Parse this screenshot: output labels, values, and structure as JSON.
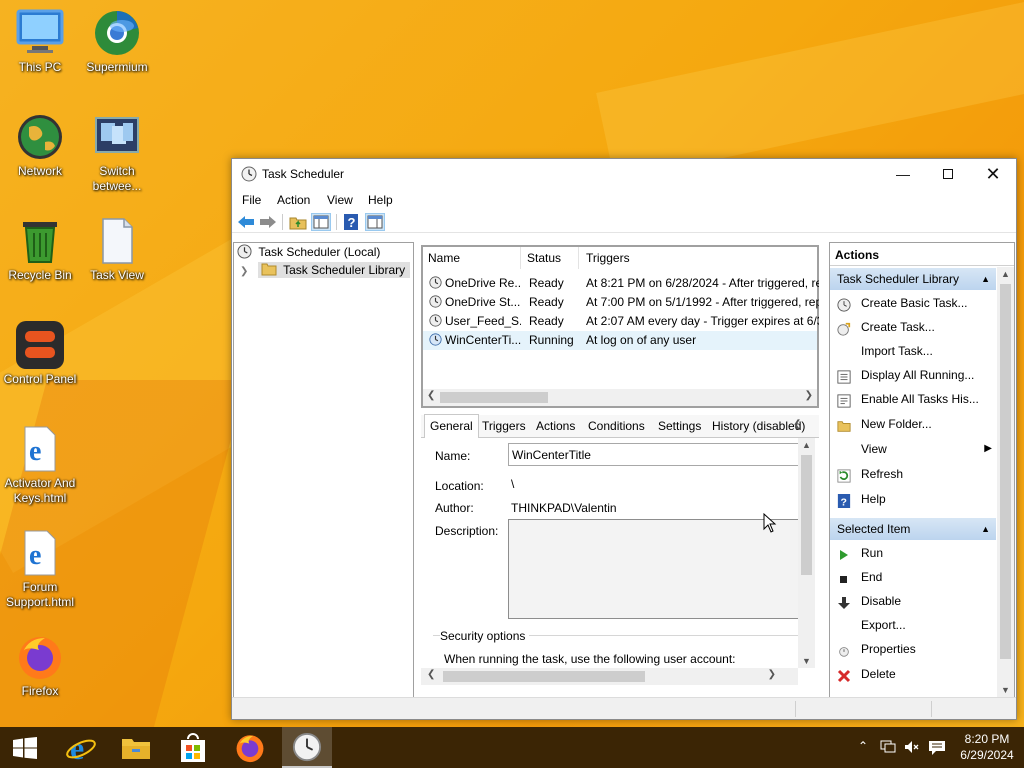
{
  "desktop": {
    "icons": [
      {
        "label": "This PC",
        "icon": "monitor-icon"
      },
      {
        "label": "Supermium",
        "icon": "browser-icon"
      },
      {
        "label": "Network",
        "icon": "globe-icon"
      },
      {
        "label": "Switch betwee...",
        "icon": "switch-windows-icon"
      },
      {
        "label": "Recycle Bin",
        "icon": "recycle-bin-icon"
      },
      {
        "label": "Task View",
        "icon": "document-icon"
      },
      {
        "label": "Control Panel",
        "icon": "control-panel-icon"
      },
      {
        "label": "Activator And Keys.html",
        "icon": "edge-html-icon"
      },
      {
        "label": "Forum Support.html",
        "icon": "edge-html-icon"
      },
      {
        "label": "Firefox",
        "icon": "firefox-icon"
      }
    ]
  },
  "window": {
    "title": "Task Scheduler",
    "menu": [
      "File",
      "Action",
      "View",
      "Help"
    ],
    "tree": {
      "root": "Task Scheduler (Local)",
      "child": "Task Scheduler Library"
    },
    "task_list": {
      "columns": [
        "Name",
        "Status",
        "Triggers"
      ],
      "rows": [
        {
          "name": "OneDrive Re...",
          "status": "Ready",
          "trigger": "At 8:21 PM on 6/28/2024 - After triggered, re"
        },
        {
          "name": "OneDrive St...",
          "status": "Ready",
          "trigger": "At 7:00 PM on 5/1/1992 - After triggered, rep"
        },
        {
          "name": "User_Feed_S...",
          "status": "Ready",
          "trigger": "At 2:07 AM every day - Trigger expires at 6/3"
        },
        {
          "name": "WinCenterTi...",
          "status": "Running",
          "trigger": "At log on of any user"
        }
      ]
    },
    "details": {
      "tabs": [
        "General",
        "Triggers",
        "Actions",
        "Conditions",
        "Settings",
        "History (disabled)"
      ],
      "name_label": "Name:",
      "name_value": "WinCenterTitle",
      "location_label": "Location:",
      "location_value": "\\",
      "author_label": "Author:",
      "author_value": "THINKPAD\\Valentin",
      "description_label": "Description:",
      "security_heading": "Security options",
      "security_text": "When running the task, use the following user account:"
    },
    "actions_pane": {
      "header": "Actions",
      "section1": "Task Scheduler Library",
      "items1": [
        {
          "label": "Create Basic Task...",
          "icon": "create-basic-task-icon"
        },
        {
          "label": "Create Task...",
          "icon": "create-task-icon"
        },
        {
          "label": "Import Task...",
          "icon": ""
        },
        {
          "label": "Display All Running...",
          "icon": "display-running-icon"
        },
        {
          "label": "Enable All Tasks His...",
          "icon": "enable-history-icon"
        },
        {
          "label": "New Folder...",
          "icon": "folder-icon"
        },
        {
          "label": "View",
          "icon": ""
        },
        {
          "label": "Refresh",
          "icon": "refresh-icon"
        },
        {
          "label": "Help",
          "icon": "help-icon"
        }
      ],
      "section2": "Selected Item",
      "items2": [
        {
          "label": "Run",
          "icon": "run-icon"
        },
        {
          "label": "End",
          "icon": "end-icon"
        },
        {
          "label": "Disable",
          "icon": "disable-icon"
        },
        {
          "label": "Export...",
          "icon": ""
        },
        {
          "label": "Properties",
          "icon": "properties-icon"
        },
        {
          "label": "Delete",
          "icon": "delete-icon"
        }
      ]
    }
  },
  "taskbar": {
    "time": "8:20 PM",
    "date": "6/29/2024",
    "apps": [
      "start-icon",
      "internet-explorer-icon",
      "file-explorer-icon",
      "store-icon",
      "firefox-icon",
      "task-scheduler-icon"
    ]
  },
  "colors": {
    "wallpaper": "#f5a80f",
    "taskbar": "#3b2505",
    "selection": "#e5f3fb",
    "section_header": "#c9dcf1"
  }
}
